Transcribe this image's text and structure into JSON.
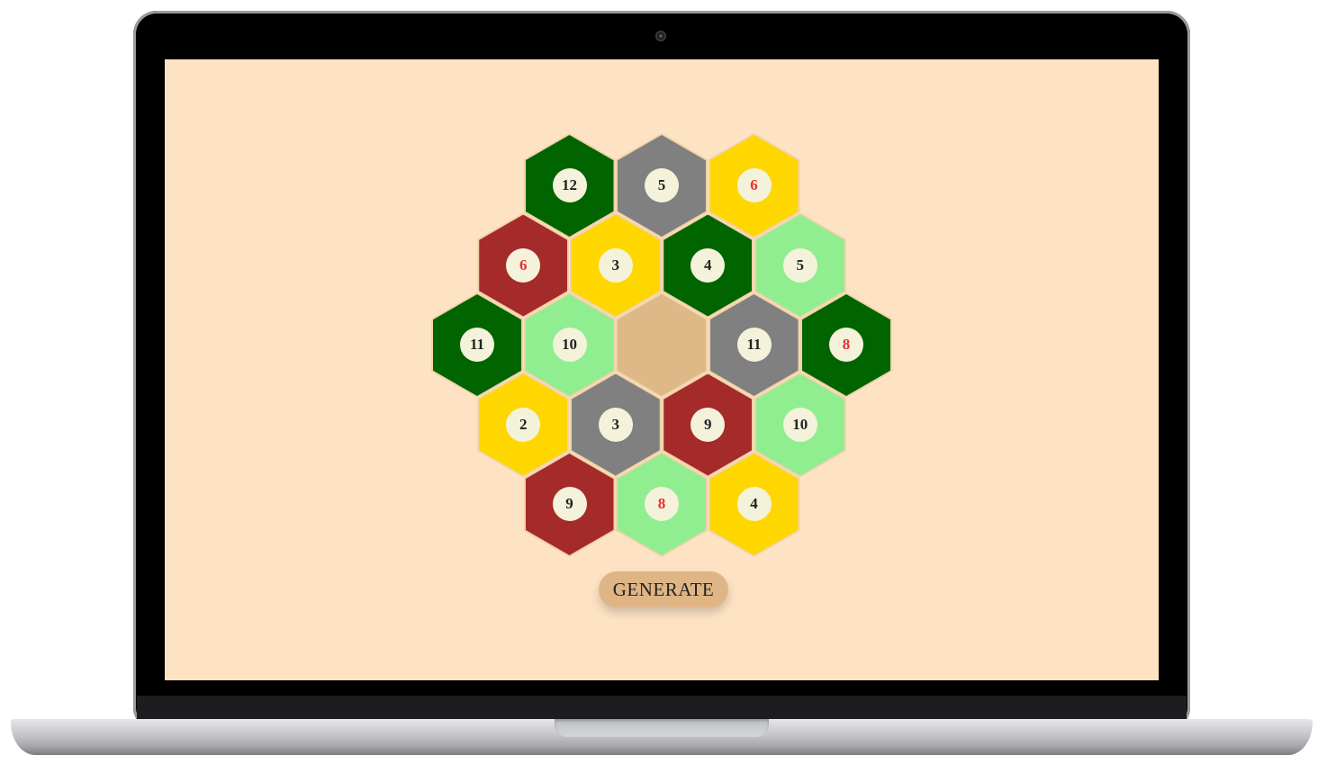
{
  "colors": {
    "screen_background": "#fde3c4",
    "hex_border": "#f0d2a8",
    "forest": "#006400",
    "mountain": "#808080",
    "field": "#ffd700",
    "hill": "#a52a2a",
    "pasture": "#90ee90",
    "desert": "#deb887",
    "token_background": "#f5f2dc",
    "token_text": "#222222",
    "token_hot_text": "#e8302f",
    "button_background": "#dfb586"
  },
  "board": {
    "rows": [
      [
        {
          "type": "forest",
          "number": "12"
        },
        {
          "type": "mountain",
          "number": "5"
        },
        {
          "type": "field",
          "number": "6",
          "hot": true
        }
      ],
      [
        {
          "type": "hill",
          "number": "6",
          "hot": true
        },
        {
          "type": "field",
          "number": "3"
        },
        {
          "type": "forest",
          "number": "4"
        },
        {
          "type": "pasture",
          "number": "5"
        }
      ],
      [
        {
          "type": "forest",
          "number": "11"
        },
        {
          "type": "pasture",
          "number": "10"
        },
        {
          "type": "desert",
          "number": ""
        },
        {
          "type": "mountain",
          "number": "11"
        },
        {
          "type": "forest",
          "number": "8",
          "hot": true
        }
      ],
      [
        {
          "type": "field",
          "number": "2"
        },
        {
          "type": "mountain",
          "number": "3"
        },
        {
          "type": "hill",
          "number": "9"
        },
        {
          "type": "pasture",
          "number": "10"
        }
      ],
      [
        {
          "type": "hill",
          "number": "9"
        },
        {
          "type": "pasture",
          "number": "8",
          "hot": true
        },
        {
          "type": "field",
          "number": "4"
        }
      ]
    ]
  },
  "generate_button": {
    "label": "GENERATE"
  }
}
